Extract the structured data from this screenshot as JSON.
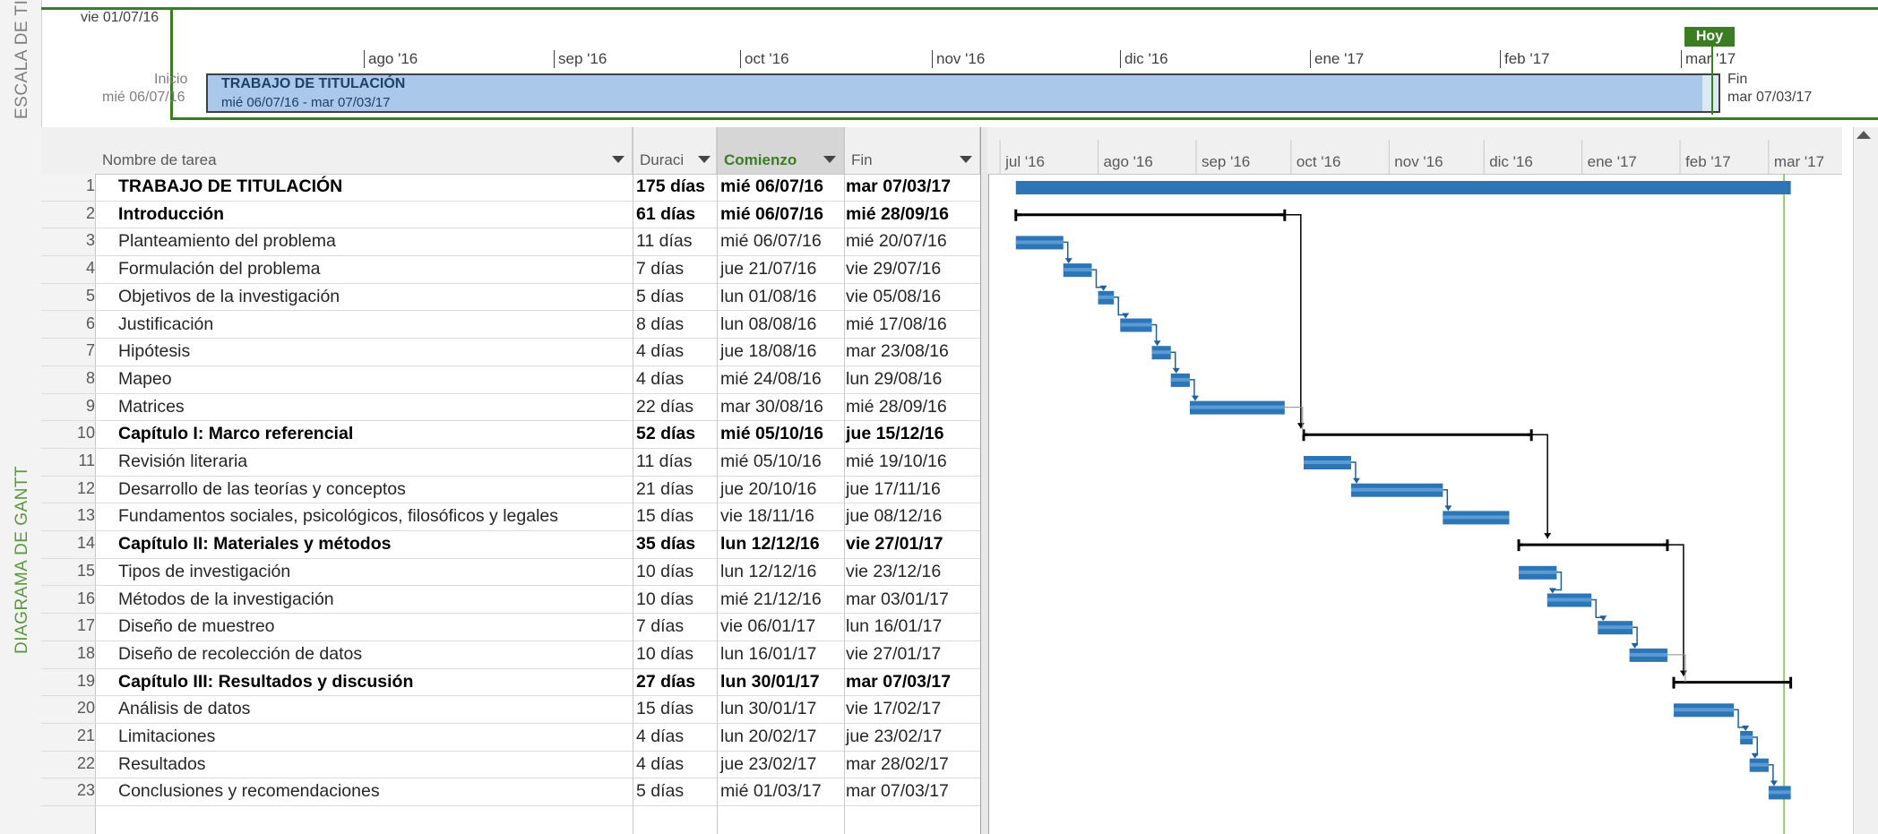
{
  "side_labels": {
    "timeline": "ESCALA DE TIEMPO",
    "gantt": "DIAGRAMA DE GANTT"
  },
  "timeline": {
    "top_date": "vie 01/07/16",
    "months": [
      "ago '16",
      "sep '16",
      "oct '16",
      "nov '16",
      "dic '16",
      "ene '17",
      "feb '17",
      "mar '17"
    ],
    "start_label": "Inicio",
    "start_date": "mié 06/07/16",
    "end_label": "Fin",
    "end_date": "mar 07/03/17",
    "bar_title": "TRABAJO DE TITULACIÓN",
    "bar_dates": "mié 06/07/16 - mar 07/03/17",
    "today_label": "Hoy"
  },
  "columns": {
    "name": "Nombre de tarea",
    "duration": "Duraci",
    "start": "Comienzo",
    "end": "Fin"
  },
  "gantt_months": [
    "jul '16",
    "ago '16",
    "sep '16",
    "oct '16",
    "nov '16",
    "dic '16",
    "ene '17",
    "feb '17",
    "mar '17"
  ],
  "colors": {
    "accent_green": "#3b7d23",
    "bar_blue": "#2e75b6",
    "summary_black": "#000000"
  },
  "tasks": [
    {
      "id": "1",
      "name": "TRABAJO DE TITULACIÓN",
      "duration": "175 días",
      "start": "mié 06/07/16",
      "end": "mar 07/03/17",
      "summary": true
    },
    {
      "id": "2",
      "name": "Introducción",
      "duration": "61 días",
      "start": "mié 06/07/16",
      "end": "mié 28/09/16",
      "summary": true
    },
    {
      "id": "3",
      "name": "Planteamiento del problema",
      "duration": "11 días",
      "start": "mié 06/07/16",
      "end": "mié 20/07/16",
      "summary": false
    },
    {
      "id": "4",
      "name": "Formulación del problema",
      "duration": "7 días",
      "start": "jue 21/07/16",
      "end": "vie 29/07/16",
      "summary": false
    },
    {
      "id": "5",
      "name": "Objetivos de la investigación",
      "duration": "5 días",
      "start": "lun 01/08/16",
      "end": "vie 05/08/16",
      "summary": false
    },
    {
      "id": "6",
      "name": "Justificación",
      "duration": "8 días",
      "start": "lun 08/08/16",
      "end": "mié 17/08/16",
      "summary": false
    },
    {
      "id": "7",
      "name": "Hipótesis",
      "duration": "4 días",
      "start": "jue 18/08/16",
      "end": "mar 23/08/16",
      "summary": false
    },
    {
      "id": "8",
      "name": "Mapeo",
      "duration": "4 días",
      "start": "mié 24/08/16",
      "end": "lun 29/08/16",
      "summary": false
    },
    {
      "id": "9",
      "name": "Matrices",
      "duration": "22 días",
      "start": "mar 30/08/16",
      "end": "mié 28/09/16",
      "summary": false
    },
    {
      "id": "10",
      "name": "Capítulo I: Marco referencial",
      "duration": "52 días",
      "start": "mié 05/10/16",
      "end": "jue 15/12/16",
      "summary": true
    },
    {
      "id": "11",
      "name": "Revisión literaria",
      "duration": "11 días",
      "start": "mié 05/10/16",
      "end": "mié 19/10/16",
      "summary": false
    },
    {
      "id": "12",
      "name": "Desarrollo de las teorías y conceptos",
      "duration": "21 días",
      "start": "jue 20/10/16",
      "end": "jue 17/11/16",
      "summary": false
    },
    {
      "id": "13",
      "name": "Fundamentos sociales, psicológicos, filosóficos y legales",
      "duration": "15 días",
      "start": "vie 18/11/16",
      "end": "jue 08/12/16",
      "summary": false
    },
    {
      "id": "14",
      "name": "Capítulo II: Materiales y métodos",
      "duration": "35 días",
      "start": "lun 12/12/16",
      "end": "vie 27/01/17",
      "summary": true
    },
    {
      "id": "15",
      "name": "Tipos de investigación",
      "duration": "10 días",
      "start": "lun 12/12/16",
      "end": "vie 23/12/16",
      "summary": false
    },
    {
      "id": "16",
      "name": "Métodos de la investigación",
      "duration": "10 días",
      "start": "mié 21/12/16",
      "end": "mar 03/01/17",
      "summary": false
    },
    {
      "id": "17",
      "name": "Diseño de muestreo",
      "duration": "7 días",
      "start": "vie 06/01/17",
      "end": "lun 16/01/17",
      "summary": false
    },
    {
      "id": "18",
      "name": "Diseño de recolección de datos",
      "duration": "10 días",
      "start": "lun 16/01/17",
      "end": "vie 27/01/17",
      "summary": false
    },
    {
      "id": "19",
      "name": "Capítulo III: Resultados y discusión",
      "duration": "27 días",
      "start": "lun 30/01/17",
      "end": "mar 07/03/17",
      "summary": true
    },
    {
      "id": "20",
      "name": "Análisis de datos",
      "duration": "15 días",
      "start": "lun 30/01/17",
      "end": "vie 17/02/17",
      "summary": false
    },
    {
      "id": "21",
      "name": "Limitaciones",
      "duration": "4 días",
      "start": "lun 20/02/17",
      "end": "jue 23/02/17",
      "summary": false
    },
    {
      "id": "22",
      "name": "Resultados",
      "duration": "4 días",
      "start": "jue 23/02/17",
      "end": "mar 28/02/17",
      "summary": false
    },
    {
      "id": "23",
      "name": "Conclusiones y recomendaciones",
      "duration": "5 días",
      "start": "mié 01/03/17",
      "end": "mar 07/03/17",
      "summary": false
    }
  ]
}
